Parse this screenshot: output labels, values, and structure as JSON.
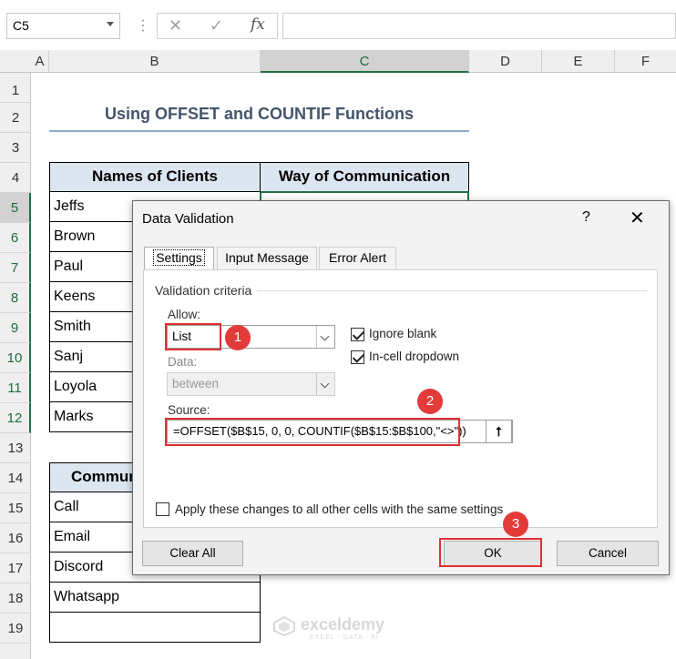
{
  "formula_bar": {
    "name_box": "C5",
    "separator": "⋮",
    "cancel": "✕",
    "enter": "✓",
    "fx": "fx",
    "formula": ""
  },
  "columns": [
    "A",
    "B",
    "C",
    "D",
    "E",
    "F"
  ],
  "rows": [
    "1",
    "2",
    "3",
    "4",
    "5",
    "6",
    "7",
    "8",
    "9",
    "10",
    "11",
    "12",
    "13",
    "14",
    "15",
    "16",
    "17",
    "18",
    "19"
  ],
  "sheet": {
    "title": "Using OFFSET and COUNTIF Functions",
    "table1": {
      "headers": [
        "Names of Clients",
        "Way of Communication"
      ],
      "names": [
        "Jeffs",
        "Brown",
        "Paul",
        "Keens",
        "Smith",
        "Sanj",
        "Loyola",
        "Marks"
      ]
    },
    "table2": {
      "header": "Commun",
      "items": [
        "Call",
        "Email",
        "Discord",
        "Whatsapp",
        ""
      ]
    }
  },
  "dialog": {
    "title": "Data Validation",
    "help": "?",
    "close": "✕",
    "tabs": [
      "Settings",
      "Input Message",
      "Error Alert"
    ],
    "section": "Validation criteria",
    "allow_label": "Allow:",
    "allow_value": "List",
    "data_label": "Data:",
    "data_value": "between",
    "ignore_blank": "Ignore blank",
    "incell_dropdown": "In-cell dropdown",
    "source_label": "Source:",
    "source_value": "=OFFSET($B$15, 0, 0, COUNTIF($B$15:$B$100,\"<>\"))",
    "apply_all": "Apply these changes to all other cells with the same settings",
    "clear_all": "Clear All",
    "ok": "OK",
    "cancel": "Cancel",
    "collapse_icon": "⭡"
  },
  "badges": [
    "1",
    "2",
    "3"
  ],
  "watermark": {
    "name": "exceldemy",
    "tagline": "EXCEL · DATA · BI"
  },
  "colors": {
    "header_fill": "#dce6f1",
    "title_color": "#44546a",
    "highlight_red": "#e03030"
  }
}
